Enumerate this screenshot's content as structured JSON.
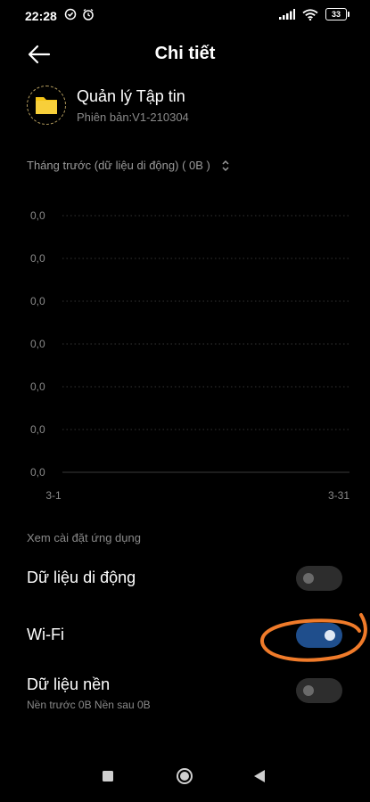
{
  "status_bar": {
    "time": "22:28",
    "battery": "33",
    "icons": [
      "check-circle-icon",
      "alarm-icon",
      "signal-icon",
      "wifi-icon",
      "battery-icon"
    ]
  },
  "header": {
    "title": "Chi tiết",
    "back_icon": "arrow-left-icon"
  },
  "app": {
    "name": "Quản lý Tập tin",
    "version": "Phiên bản:V1-210304",
    "icon": "folder-icon",
    "icon_color": "#f5c518"
  },
  "period": {
    "label": "Tháng trước (dữ liệu di động) ( 0B )",
    "icon": "chevron-up-down-icon"
  },
  "chart_data": {
    "type": "line",
    "yticks": [
      "0,0",
      "0,0",
      "0,0",
      "0,0",
      "0,0",
      "0,0",
      "0,0"
    ],
    "xticks": [
      "3-1",
      "3-31"
    ],
    "series": [
      {
        "values": [
          0,
          0
        ]
      }
    ],
    "grid": true
  },
  "settings": {
    "section_label": "Xem cài đặt ứng dụng",
    "mobile_data": {
      "label": "Dữ liệu di động",
      "enabled": false
    },
    "wifi": {
      "label": "Wi-Fi",
      "enabled": true
    },
    "background_data": {
      "label": "Dữ liệu nền",
      "sub": "Nền trước 0B  Nền sau 0B",
      "enabled": false
    }
  },
  "colors": {
    "toggle_on": "#1f4e8c",
    "toggle_off": "#2d2d2d",
    "annotation": "#f07b2a"
  },
  "nav_bar": {
    "items": [
      "square-icon",
      "circle-icon",
      "triangle-back-icon"
    ]
  }
}
